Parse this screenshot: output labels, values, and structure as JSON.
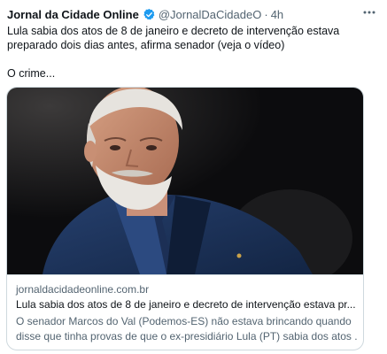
{
  "tweet": {
    "author_name": "Jornal da Cidade Online",
    "author_handle": "@JornalDaCidadeO",
    "separator": "·",
    "timestamp": "4h",
    "text_line1": "Lula sabia dos atos de 8 de janeiro e decreto de intervenção estava",
    "text_line2": "preparado dois dias antes, afirma senador (veja o vídeo)",
    "text_line3": "O crime...",
    "icons": {
      "verified": "verified-badge-icon",
      "more": "more-options-icon"
    },
    "colors": {
      "verified_badge": "#1d9bf0",
      "secondary_text": "#536471",
      "border": "#cfd9de"
    }
  },
  "card": {
    "domain": "jornaldacidadeonline.com.br",
    "title": "Lula sabia dos atos de 8 de janeiro e decreto de intervenção estava pr...",
    "description_line1": "O senador Marcos do Val (Podemos-ES) não estava brincando quando",
    "description_line2": "disse que tinha provas de que o ex-presidiário Lula (PT) sabia dos atos ..."
  }
}
